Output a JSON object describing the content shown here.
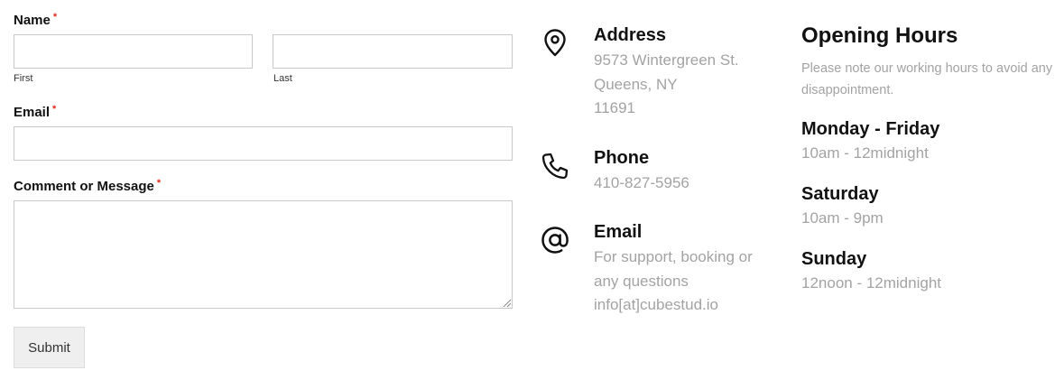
{
  "form": {
    "name_label": "Name",
    "required_mark": "*",
    "first_sublabel": "First",
    "last_sublabel": "Last",
    "first_value": "",
    "last_value": "",
    "email_label": "Email",
    "email_value": "",
    "message_label": "Comment or Message",
    "message_value": "",
    "submit_label": "Submit"
  },
  "contact": {
    "address": {
      "icon": "map-pin-icon",
      "title": "Address",
      "lines": [
        "9573 Wintergreen St.",
        "Queens, NY",
        "11691"
      ]
    },
    "phone": {
      "icon": "phone-icon",
      "title": "Phone",
      "value": "410-827-5956"
    },
    "email": {
      "icon": "at-sign-icon",
      "title": "Email",
      "lines": [
        "For support, booking or",
        "any questions",
        "info[at]cubestud.io"
      ]
    }
  },
  "hours": {
    "title": "Opening Hours",
    "note": "Please note our working hours to avoid any disappointment.",
    "days": [
      {
        "day": "Monday - Friday",
        "time": "10am - 12midnight"
      },
      {
        "day": "Saturday",
        "time": "10am - 9pm"
      },
      {
        "day": "Sunday",
        "time": "12noon - 12midnight"
      }
    ]
  },
  "colors": {
    "required": "#e02b20",
    "muted_text": "#a3a3a3",
    "input_border": "#c9c9c9",
    "button_bg": "#efefef"
  }
}
